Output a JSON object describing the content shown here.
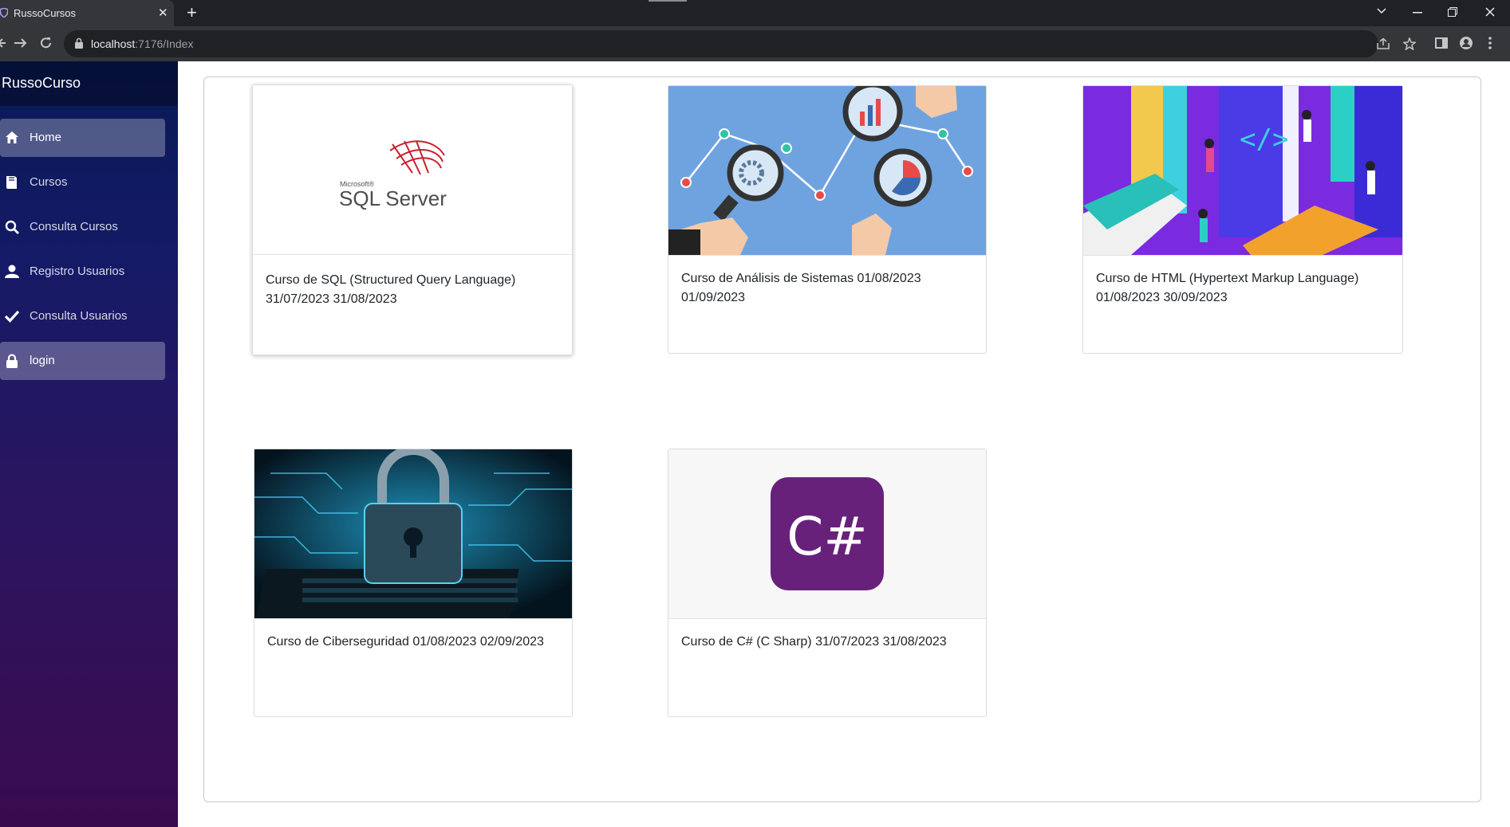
{
  "browser": {
    "tab_title": "RussoCursos",
    "tab_close": "✕",
    "new_tab": "+",
    "url_host": "localhost",
    "url_path": ":7176/Index"
  },
  "sidebar": {
    "brand": "RussoCurso",
    "items": [
      {
        "label": "Home",
        "icon": "home-icon",
        "active": true
      },
      {
        "label": "Cursos",
        "icon": "book-icon",
        "active": false
      },
      {
        "label": "Consulta Cursos",
        "icon": "search-icon",
        "active": false
      },
      {
        "label": "Registro Usuarios",
        "icon": "user-icon",
        "active": false
      },
      {
        "label": "Consulta Usuarios",
        "icon": "check-icon",
        "active": false
      },
      {
        "label": "login",
        "icon": "lock-icon",
        "active": true
      }
    ]
  },
  "courses": [
    {
      "title": "Curso de SQL (Structured Query Language) 31/07/2023 31/08/2023",
      "image": "sql-server-logo",
      "logo_small": "Microsoft®",
      "logo_big": "SQL Server"
    },
    {
      "title": "Curso de Análisis de Sistemas 01/08/2023 01/09/2023",
      "image": "analysis-illustration"
    },
    {
      "title": "Curso de HTML (Hypertext Markup Language) 01/08/2023 30/09/2023",
      "image": "html-illustration"
    },
    {
      "title": "Curso de Ciberseguridad 01/08/2023 02/09/2023",
      "image": "padlock-illustration"
    },
    {
      "title": "Curso de C# (C Sharp) 31/07/2023 31/08/2023",
      "image": "csharp-logo",
      "logo_text": "C#"
    }
  ],
  "colors": {
    "sidebar_top": "#081a55",
    "sidebar_bottom": "#3a0a4e",
    "csharp": "#68217a"
  }
}
